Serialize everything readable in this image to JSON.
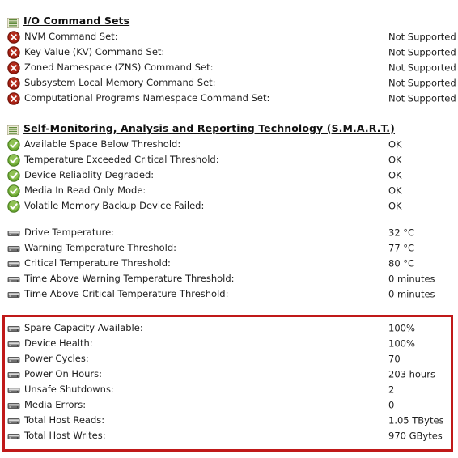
{
  "sections": [
    {
      "id": "io-command-sets",
      "title": "I/O Command Sets",
      "icon": "list-lines-icon",
      "rows": [
        {
          "icon": "error-x-icon",
          "label": "NVM Command Set:",
          "value": "Not Supported"
        },
        {
          "icon": "error-x-icon",
          "label": "Key Value (KV) Command Set:",
          "value": "Not Supported"
        },
        {
          "icon": "error-x-icon",
          "label": "Zoned Namespace (ZNS) Command Set:",
          "value": "Not Supported"
        },
        {
          "icon": "error-x-icon",
          "label": "Subsystem Local Memory Command Set:",
          "value": "Not Supported"
        },
        {
          "icon": "error-x-icon",
          "label": "Computational Programs Namespace Command Set:",
          "value": "Not Supported"
        }
      ]
    },
    {
      "id": "smart",
      "title": "Self-Monitoring, Analysis and Reporting Technology (S.M.A.R.T.)",
      "icon": "list-lines-icon",
      "rows": [
        {
          "icon": "ok-check-icon",
          "label": "Available Space Below Threshold:",
          "value": "OK"
        },
        {
          "icon": "ok-check-icon",
          "label": "Temperature Exceeded Critical Threshold:",
          "value": "OK"
        },
        {
          "icon": "ok-check-icon",
          "label": "Device Reliablity Degraded:",
          "value": "OK"
        },
        {
          "icon": "ok-check-icon",
          "label": "Media In Read Only Mode:",
          "value": "OK"
        },
        {
          "icon": "ok-check-icon",
          "label": "Volatile Memory Backup Device Failed:",
          "value": "OK"
        }
      ]
    },
    {
      "id": "temperatures",
      "title": "",
      "icon": "",
      "rows": [
        {
          "icon": "drive-icon",
          "label": "Drive Temperature:",
          "value": "32 °C"
        },
        {
          "icon": "drive-icon",
          "label": "Warning Temperature Threshold:",
          "value": "77 °C"
        },
        {
          "icon": "drive-icon",
          "label": "Critical Temperature Threshold:",
          "value": "80 °C"
        },
        {
          "icon": "drive-icon",
          "label": "Time Above Warning Temperature Threshold:",
          "value": "0 minutes"
        },
        {
          "icon": "drive-icon",
          "label": "Time Above Critical Temperature Threshold:",
          "value": "0 minutes"
        }
      ]
    }
  ],
  "highlighted_section": {
    "id": "health-statistics",
    "highlight_color": "#c01919",
    "rows": [
      {
        "icon": "drive-icon",
        "label": "Spare Capacity Available:",
        "value": "100%"
      },
      {
        "icon": "drive-icon",
        "label": "Device Health:",
        "value": "100%"
      },
      {
        "icon": "drive-icon",
        "label": "Power Cycles:",
        "value": "70"
      },
      {
        "icon": "drive-icon",
        "label": "Power On Hours:",
        "value": "203 hours"
      },
      {
        "icon": "drive-icon",
        "label": "Unsafe Shutdowns:",
        "value": "2"
      },
      {
        "icon": "drive-icon",
        "label": "Media Errors:",
        "value": "0"
      },
      {
        "icon": "drive-icon",
        "label": "Total Host Reads:",
        "value": "1.05 TBytes"
      },
      {
        "icon": "drive-icon",
        "label": "Total Host Writes:",
        "value": "970 GBytes"
      }
    ]
  }
}
